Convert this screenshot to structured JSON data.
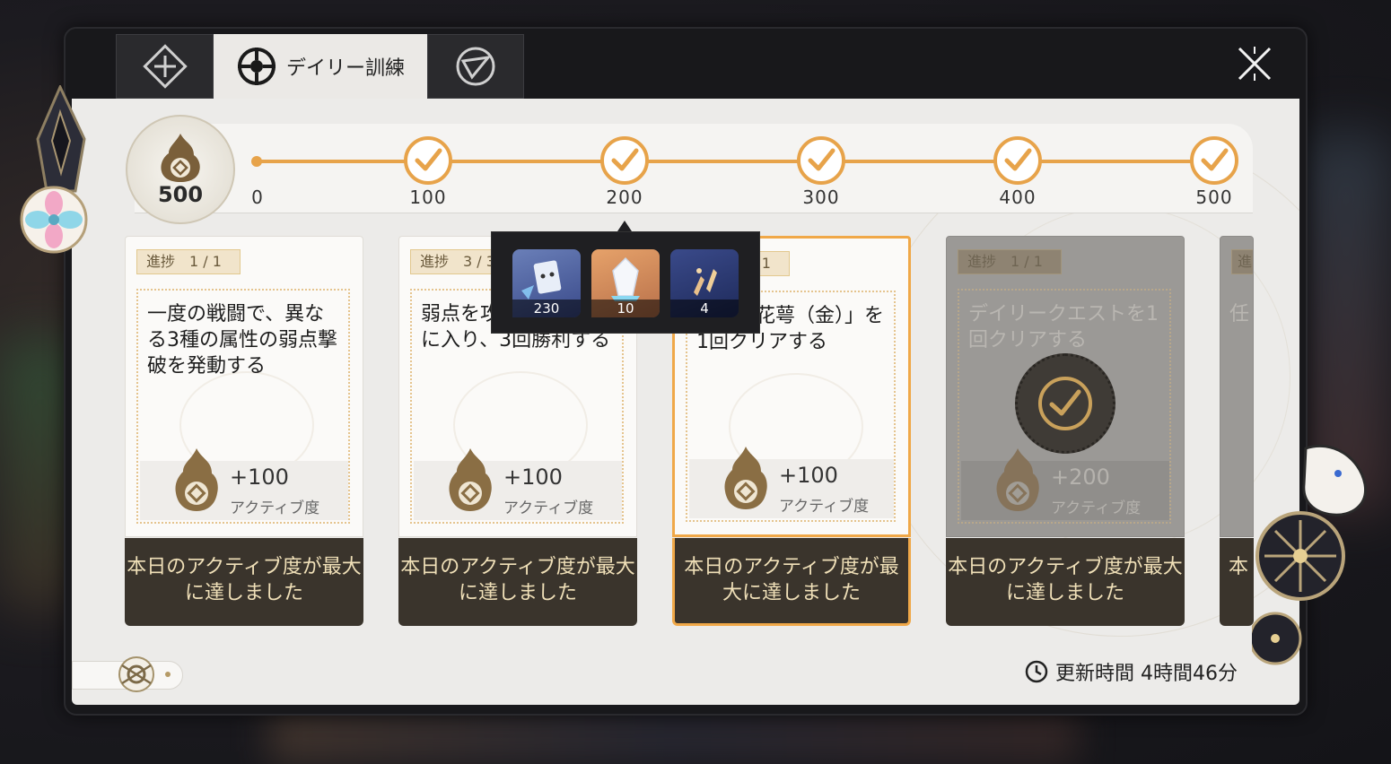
{
  "tabs": [
    {
      "name": "tab-guide",
      "label": ""
    },
    {
      "name": "tab-daily",
      "label": "デイリー訓練"
    },
    {
      "name": "tab-other",
      "label": ""
    }
  ],
  "activity": {
    "current": "500",
    "milestones": [
      "0",
      "100",
      "200",
      "300",
      "400",
      "500"
    ]
  },
  "tooltip_items": [
    {
      "icon": "trailblaze-exp-icon",
      "qty": "230"
    },
    {
      "icon": "crystal-shard-icon",
      "qty": "10"
    },
    {
      "icon": "credit-fragments-icon",
      "qty": "4"
    }
  ],
  "cards": [
    {
      "progress": "進捗　1 / 1",
      "text": "一度の戦闘で、異なる3種の属性の弱点撃破を発動する",
      "reward": "+100",
      "reward_label": "アクティブ度",
      "footer": "本日のアクティブ度が最大に達しました"
    },
    {
      "progress": "進捗　3 / 3",
      "text": "弱点を攻撃して戦闘に入り、3回勝利する",
      "reward": "+100",
      "reward_label": "アクティブ度",
      "footer": "本日のアクティブ度が最大に達しました"
    },
    {
      "progress": "進捗　1 / 1",
      "text": "「擬似花萼（金）」を1回クリアする",
      "reward": "+100",
      "reward_label": "アクティブ度",
      "footer": "本日のアクティブ度が最大に達しました"
    },
    {
      "progress": "進捗　1 / 1",
      "text": "デイリークエストを1回クリアする",
      "reward": "+200",
      "reward_label": "アクティブ度",
      "footer": "本日のアクティブ度が最大に達しました"
    },
    {
      "progress": "進",
      "text": "任",
      "footer": "本"
    }
  ],
  "update": {
    "label": "更新時間 4時間46分"
  },
  "colors": {
    "accent": "#e7a34a",
    "footer_bg": "#3a342c",
    "footer_text": "#f0e0b8"
  }
}
